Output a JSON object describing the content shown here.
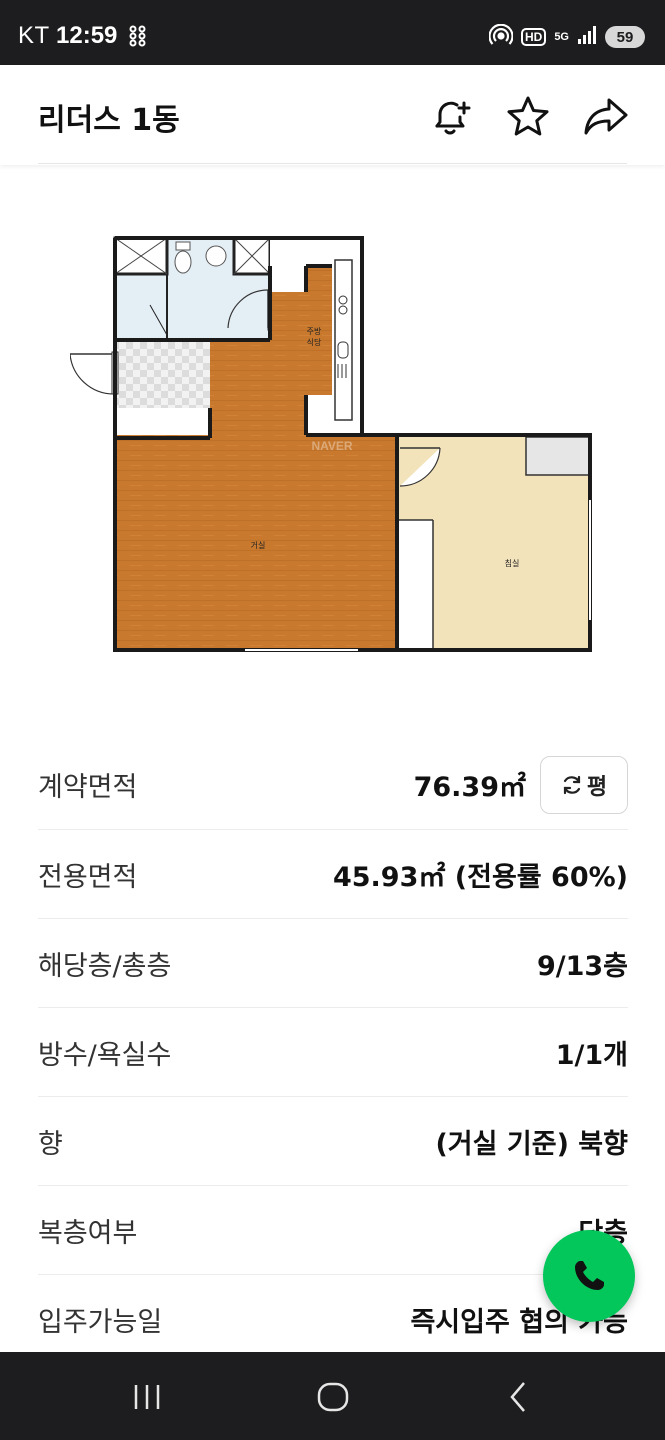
{
  "status_bar": {
    "carrier": "KT",
    "time": "12:59",
    "network": "5G",
    "hd_label": "HD",
    "battery": "59"
  },
  "header": {
    "title": "리더스 1동",
    "icons": [
      "bell-plus-icon",
      "star-icon",
      "share-icon"
    ]
  },
  "floorplan": {
    "rooms": {
      "kitchen": "주방\n식당",
      "kitchen_line1": "주방",
      "kitchen_line2": "식당",
      "living": "거실",
      "bedroom": "침실"
    },
    "watermark": "NAVER"
  },
  "info": {
    "rows": [
      {
        "label": "계약면적",
        "value": "76.39㎡"
      },
      {
        "label": "전용면적",
        "value": "45.93㎡ (전용률 60%)"
      },
      {
        "label": "해당층/총층",
        "value": "9/13층"
      },
      {
        "label": "방수/욕실수",
        "value": "1/1개"
      },
      {
        "label": "향",
        "value": "(거실 기준) 북향"
      },
      {
        "label": "복층여부",
        "value": "단층"
      },
      {
        "label": "입주가능일",
        "value": "즉시입주 협의 가능"
      }
    ],
    "unit_toggle_label": "평"
  },
  "colors": {
    "accent_green": "#03c75a",
    "status_bar_bg": "#1d1d1f"
  }
}
